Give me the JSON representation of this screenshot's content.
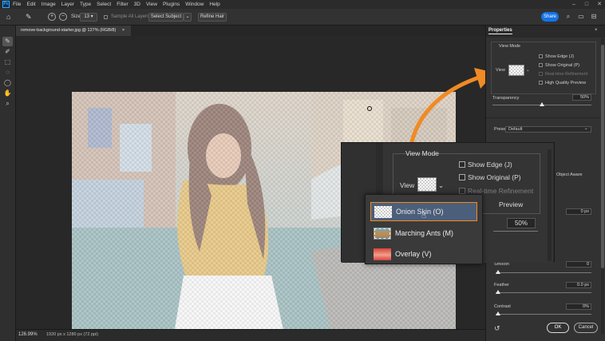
{
  "menubar": {
    "app_logo": "Ps",
    "items": [
      "File",
      "Edit",
      "Image",
      "Layer",
      "Type",
      "Select",
      "Filter",
      "3D",
      "View",
      "Plugins",
      "Window",
      "Help"
    ],
    "window_controls": [
      "–",
      "□",
      "✕"
    ]
  },
  "options_bar": {
    "size_label": "Size:",
    "size_value": "13",
    "sample_all_layers": "Sample All Layers",
    "select_subject": "Select Subject",
    "refine_hair": "Refine Hair",
    "share": "Share"
  },
  "document": {
    "tab_title": "remove-background-starter.jpg @ 127% (RGB/8)",
    "tab_close": "×"
  },
  "statusbar": {
    "zoom": "126.99%",
    "dimensions": "1920 px x 1280 px (72 ppi)"
  },
  "properties": {
    "tab": "Properties",
    "view_mode_label": "View Mode",
    "view_label": "View",
    "show_edge": "Show Edge (J)",
    "show_original": "Show Original (P)",
    "realtime_refinement": "Real-time Refinement",
    "high_quality_preview": "High Quality Preview",
    "transparency_label": "Transparency",
    "transparency_value": "50%",
    "transparency_level": 0.5,
    "preset_label": "Preset",
    "preset_value": "Default",
    "object_aware": "Object Aware",
    "radius_value": "0 px",
    "smooth_label": "Smooth",
    "smooth_value": "0",
    "feather_label": "Feather",
    "feather_value": "0.0 px",
    "contrast_label": "Contrast",
    "contrast_value": "0%",
    "ok": "OK",
    "cancel": "Cancel"
  },
  "callout": {
    "view_mode": "View Mode",
    "show_edge": "Show Edge (J)",
    "show_original": "Show Original (P)",
    "realtime_refinement": "Real-time Refinement",
    "view_label": "View",
    "preview": "Preview",
    "transparency_value": "50%"
  },
  "view_dropdown": {
    "items": [
      {
        "label": "Onion Skin (O)",
        "selected": true
      },
      {
        "label": "Marching Ants (M)",
        "selected": false
      },
      {
        "label": "Overlay (V)",
        "selected": false
      }
    ]
  },
  "colors": {
    "accent_orange": "#f08a24",
    "selection_blue": "#4c5f7a",
    "share_blue": "#1473e6"
  }
}
